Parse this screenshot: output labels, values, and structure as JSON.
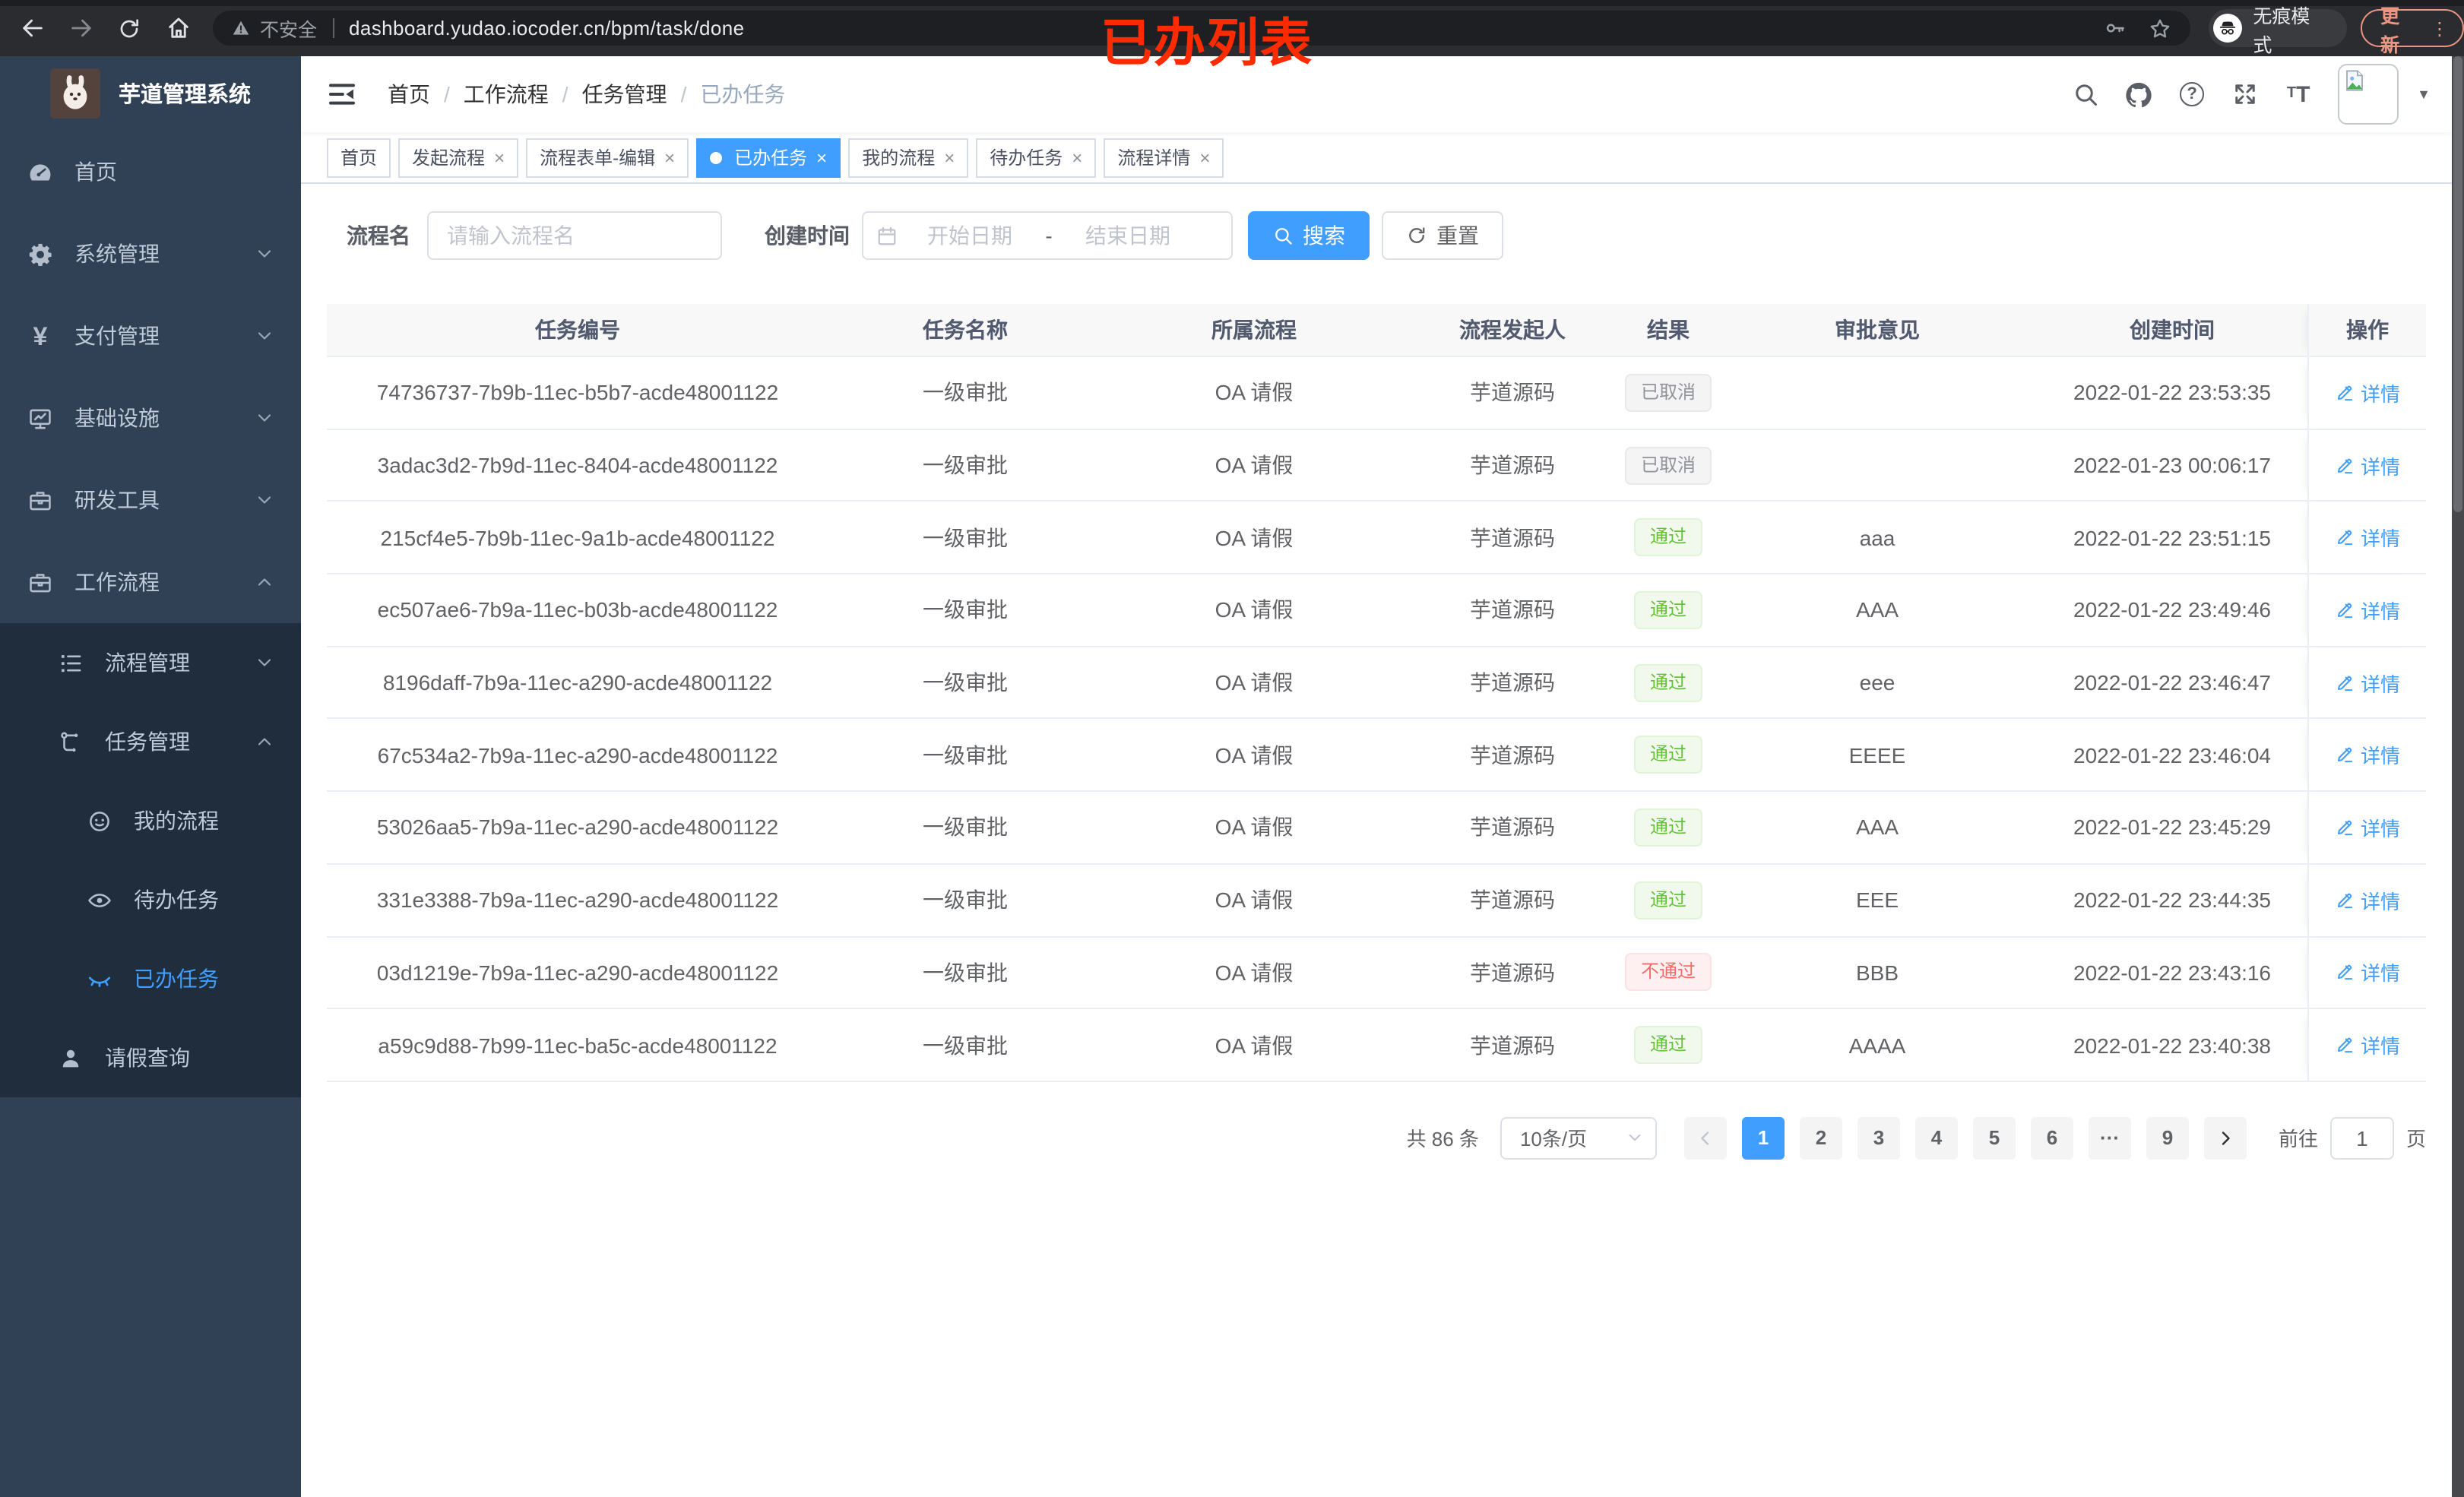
{
  "colors": {
    "accent": "#409eff",
    "success": "#67c23a",
    "danger": "#f56c6c",
    "info": "#909399",
    "sidebar_bg": "#304156",
    "submenu_bg": "#1f2d3d"
  },
  "glyphs": {
    "close": "×",
    "breadcrumb_separator": "/",
    "caret_down": "▼",
    "question_mark": "?",
    "font_large": "T",
    "font_small": "T",
    "menu_dots": "⋮",
    "ellipsis": "···",
    "yen": "¥"
  },
  "browser": {
    "security_label": "不安全",
    "url": "dashboard.yudao.iocoder.cn/bpm/task/done",
    "incognito_label": "无痕模式",
    "update_label": "更新",
    "annotation": "已办列表"
  },
  "sidebar": {
    "title": "芋道管理系统",
    "items": [
      {
        "label": "首页"
      },
      {
        "label": "系统管理"
      },
      {
        "label": "支付管理"
      },
      {
        "label": "基础设施"
      },
      {
        "label": "研发工具"
      },
      {
        "label": "工作流程"
      }
    ],
    "subitems": [
      {
        "label": "流程管理"
      },
      {
        "label": "任务管理"
      },
      {
        "label": "我的流程"
      },
      {
        "label": "待办任务"
      },
      {
        "label": "已办任务"
      },
      {
        "label": "请假查询"
      }
    ]
  },
  "navbar": {
    "breadcrumb": [
      "首页",
      "工作流程",
      "任务管理",
      "已办任务"
    ]
  },
  "tabs": [
    {
      "label": "首页"
    },
    {
      "label": "发起流程"
    },
    {
      "label": "流程表单-编辑"
    },
    {
      "label": "已办任务"
    },
    {
      "label": "我的流程"
    },
    {
      "label": "待办任务"
    },
    {
      "label": "流程详情"
    }
  ],
  "filters": {
    "name_label": "流程名",
    "name_placeholder": "请输入流程名",
    "date_label": "创建时间",
    "date_start_placeholder": "开始日期",
    "date_separator": "-",
    "date_end_placeholder": "结束日期",
    "search_label": "搜索",
    "reset_label": "重置"
  },
  "table": {
    "columns": [
      "任务编号",
      "任务名称",
      "所属流程",
      "流程发起人",
      "结果",
      "审批意见",
      "创建时间",
      "操作"
    ],
    "action_label": "详情",
    "rows": [
      {
        "id": "74736737-7b9b-11ec-b5b7-acde48001122",
        "name": "一级审批",
        "flow": "OA 请假",
        "starter": "芋道源码",
        "result": "已取消",
        "opinion": "",
        "time": "2022-01-22 23:53:35"
      },
      {
        "id": "3adac3d2-7b9d-11ec-8404-acde48001122",
        "name": "一级审批",
        "flow": "OA 请假",
        "starter": "芋道源码",
        "result": "已取消",
        "opinion": "",
        "time": "2022-01-23 00:06:17"
      },
      {
        "id": "215cf4e5-7b9b-11ec-9a1b-acde48001122",
        "name": "一级审批",
        "flow": "OA 请假",
        "starter": "芋道源码",
        "result": "通过",
        "opinion": "aaa",
        "time": "2022-01-22 23:51:15"
      },
      {
        "id": "ec507ae6-7b9a-11ec-b03b-acde48001122",
        "name": "一级审批",
        "flow": "OA 请假",
        "starter": "芋道源码",
        "result": "通过",
        "opinion": "AAA",
        "time": "2022-01-22 23:49:46"
      },
      {
        "id": "8196daff-7b9a-11ec-a290-acde48001122",
        "name": "一级审批",
        "flow": "OA 请假",
        "starter": "芋道源码",
        "result": "通过",
        "opinion": "eee",
        "time": "2022-01-22 23:46:47"
      },
      {
        "id": "67c534a2-7b9a-11ec-a290-acde48001122",
        "name": "一级审批",
        "flow": "OA 请假",
        "starter": "芋道源码",
        "result": "通过",
        "opinion": "EEEE",
        "time": "2022-01-22 23:46:04"
      },
      {
        "id": "53026aa5-7b9a-11ec-a290-acde48001122",
        "name": "一级审批",
        "flow": "OA 请假",
        "starter": "芋道源码",
        "result": "通过",
        "opinion": "AAA",
        "time": "2022-01-22 23:45:29"
      },
      {
        "id": "331e3388-7b9a-11ec-a290-acde48001122",
        "name": "一级审批",
        "flow": "OA 请假",
        "starter": "芋道源码",
        "result": "通过",
        "opinion": "EEE",
        "time": "2022-01-22 23:44:35"
      },
      {
        "id": "03d1219e-7b9a-11ec-a290-acde48001122",
        "name": "一级审批",
        "flow": "OA 请假",
        "starter": "芋道源码",
        "result": "不通过",
        "opinion": "BBB",
        "time": "2022-01-22 23:43:16"
      },
      {
        "id": "a59c9d88-7b99-11ec-ba5c-acde48001122",
        "name": "一级审批",
        "flow": "OA 请假",
        "starter": "芋道源码",
        "result": "通过",
        "opinion": "AAAA",
        "time": "2022-01-22 23:40:38"
      }
    ]
  },
  "pagination": {
    "total_text": "共 86 条",
    "page_size": "10条/页",
    "pages": [
      "1",
      "2",
      "3",
      "4",
      "5",
      "6",
      "···",
      "9"
    ],
    "active_page": "1",
    "goto_label": "前往",
    "goto_value": "1",
    "page_unit": "页"
  }
}
